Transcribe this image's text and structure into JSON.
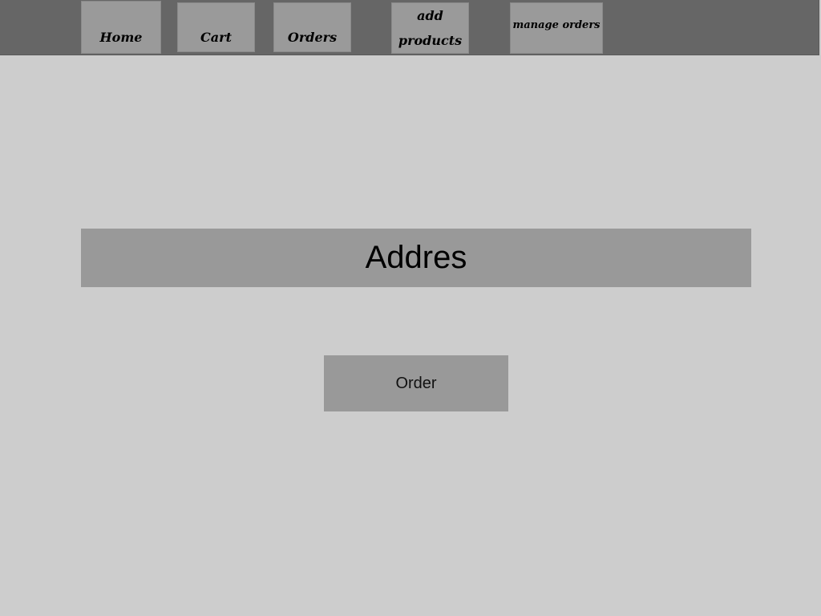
{
  "nav": {
    "home_label": "Home",
    "cart_label": "Cart",
    "orders_label": "Orders",
    "add_products_label": "add products",
    "manage_orders_label": "manage orders"
  },
  "checkout": {
    "address_placeholder": "Addres",
    "address_value": "",
    "order_button_label": "Order"
  },
  "colors": {
    "navbar_bg": "#666666",
    "nav_button_bg": "#9a9a9a",
    "page_bg": "#cdcdcd",
    "field_bg": "#999999"
  }
}
